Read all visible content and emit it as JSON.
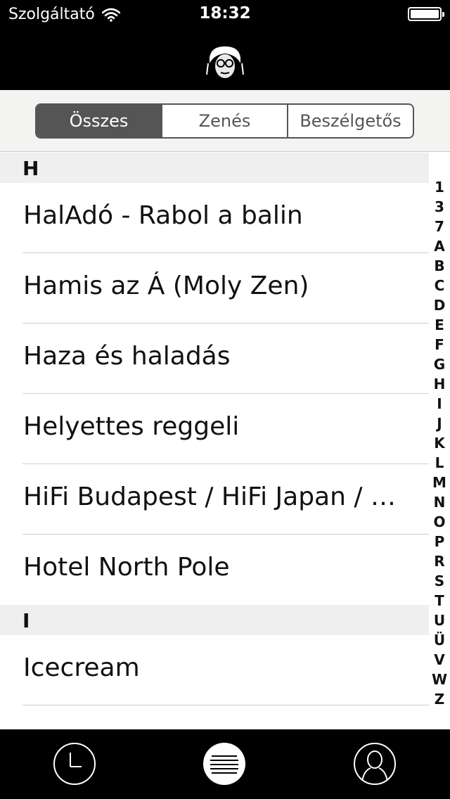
{
  "status": {
    "carrier": "Szolgáltató",
    "time": "18:32"
  },
  "segments": [
    {
      "label": "Összes",
      "selected": true
    },
    {
      "label": "Zenés",
      "selected": false
    },
    {
      "label": "Beszélgetős",
      "selected": false
    }
  ],
  "sections": [
    {
      "letter": "H",
      "items": [
        "HalAdó - Rabol a balin",
        "Hamis az Á (Moly Zen)",
        "Haza és haladás",
        "Helyettes reggeli",
        "HiFi Budapest / HiFi Japan / HiFi Amerika",
        "Hotel North Pole"
      ]
    },
    {
      "letter": "I",
      "items": [
        "Icecream"
      ]
    }
  ],
  "index_letters": [
    "1",
    "3",
    "7",
    "A",
    "B",
    "C",
    "D",
    "E",
    "F",
    "G",
    "H",
    "I",
    "J",
    "K",
    "L",
    "M",
    "N",
    "O",
    "P",
    "R",
    "S",
    "T",
    "U",
    "Ü",
    "V",
    "W",
    "Z"
  ],
  "tabs": {
    "history": "clock-icon",
    "list": "list-icon",
    "profile": "person-icon"
  }
}
